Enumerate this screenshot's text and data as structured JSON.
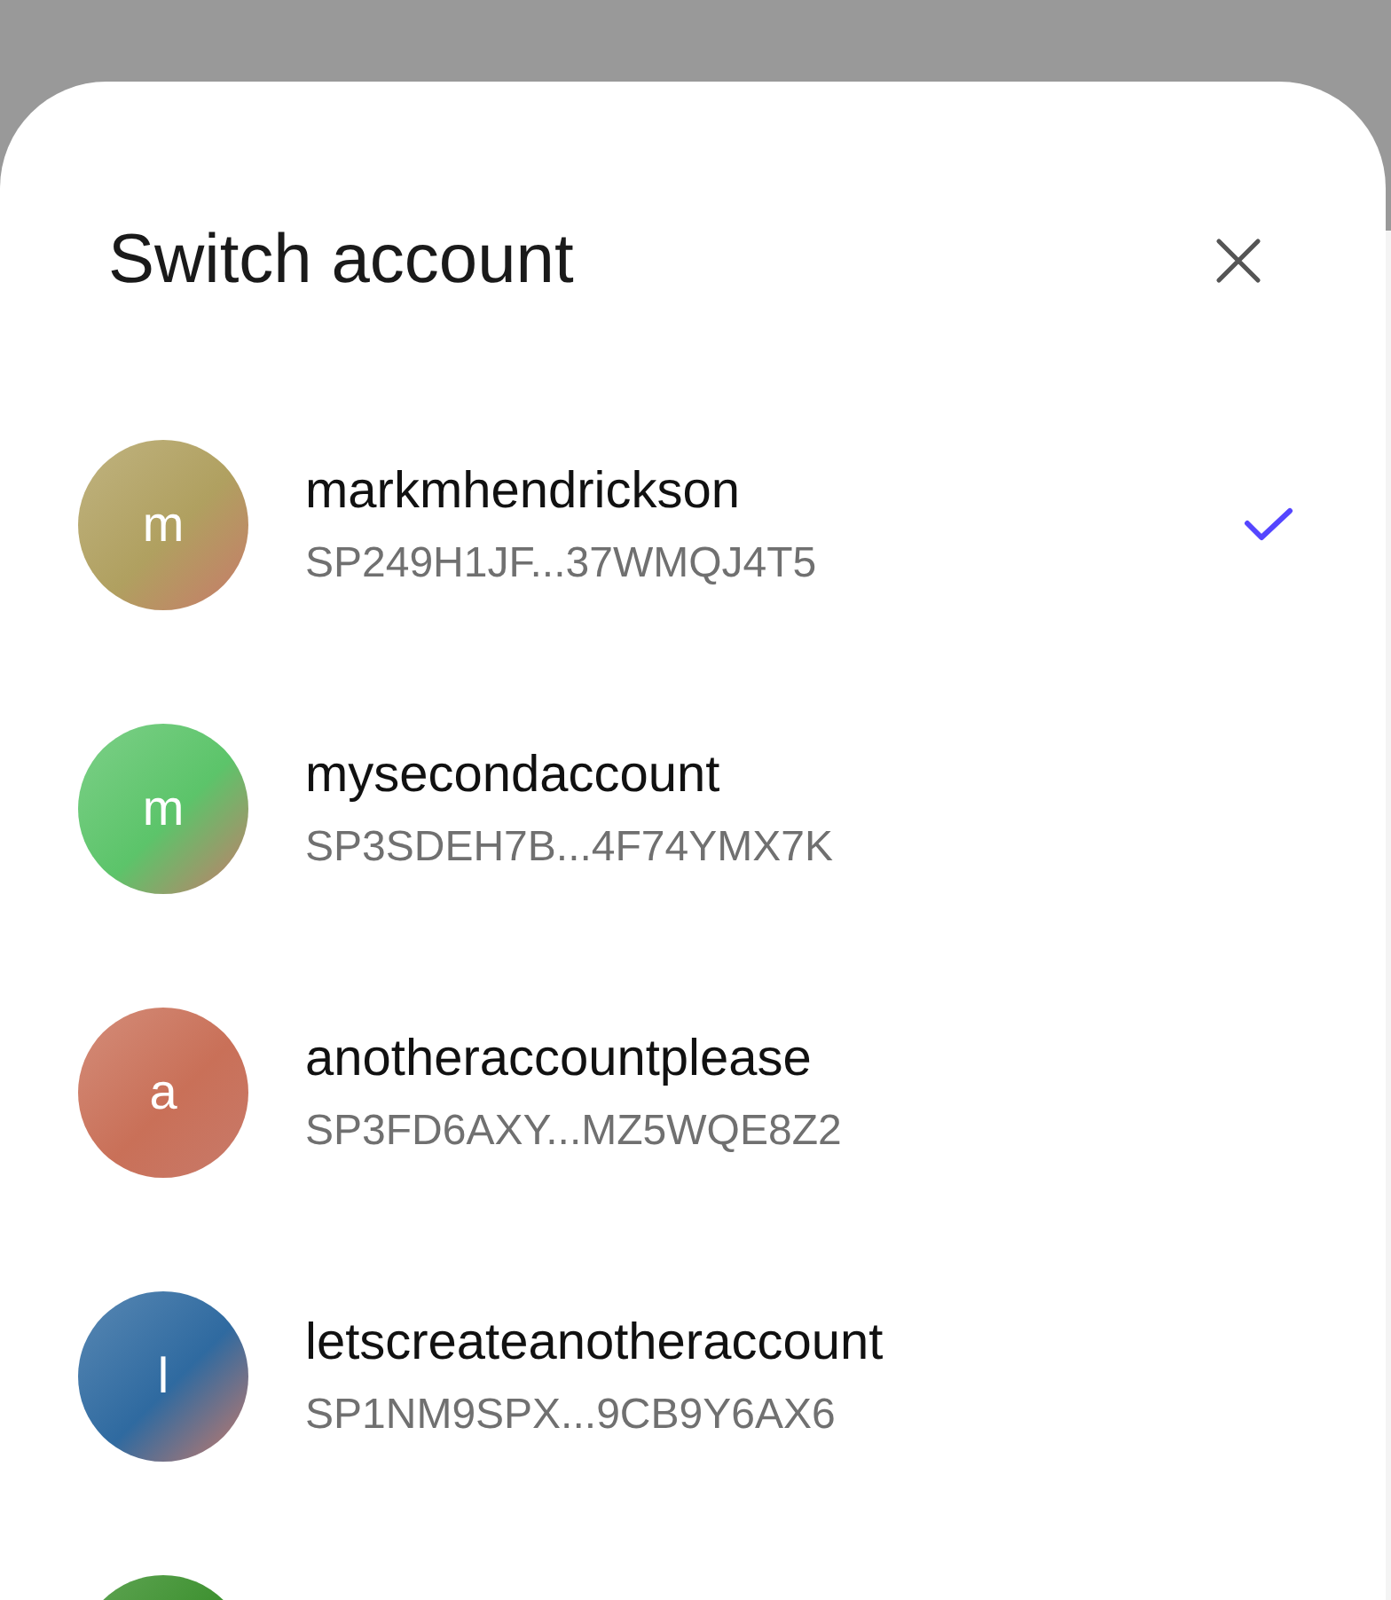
{
  "dialog": {
    "title": "Switch account"
  },
  "accounts": [
    {
      "name": "markmhendrickson",
      "address": "SP249H1JF...37WMQJ4T5",
      "initial": "m",
      "color": "#b0a060",
      "selected": true
    },
    {
      "name": "mysecondaccount",
      "address": "SP3SDEH7B...4F74YMX7K",
      "initial": "m",
      "color": "#5cc46a",
      "selected": false
    },
    {
      "name": "anotheraccountplease",
      "address": "SP3FD6AXY...MZ5WQE8Z2",
      "initial": "a",
      "color": "#c97058",
      "selected": false
    },
    {
      "name": "letscreateanotheraccount",
      "address": "SP1NM9SPX...9CB9Y6AX6",
      "initial": "l",
      "color": "#2f6aa0",
      "selected": false
    },
    {
      "color": "#3a8f2c"
    }
  ]
}
